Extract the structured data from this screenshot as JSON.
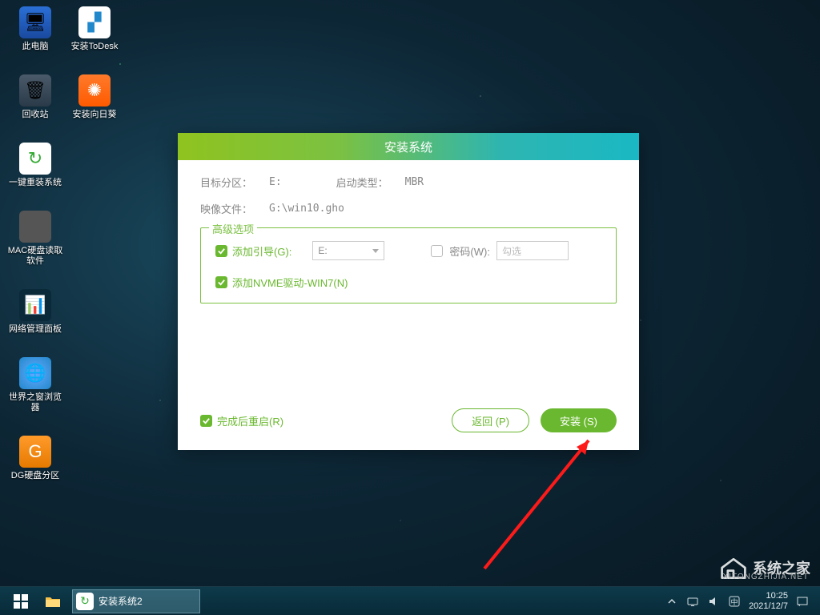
{
  "desktop_icons_col1": [
    {
      "label": "此电脑",
      "cls": "pc-icon",
      "glyph": "🖥"
    },
    {
      "label": "回收站",
      "cls": "recycle",
      "glyph": "🗑"
    },
    {
      "label": "一键重装系统",
      "cls": "reinstall",
      "glyph": "↻"
    },
    {
      "label": "MAC硬盘读取软件",
      "cls": "macdisk",
      "glyph": ""
    },
    {
      "label": "网络管理面板",
      "cls": "netpanel",
      "glyph": "📊"
    },
    {
      "label": "世界之窗浏览器",
      "cls": "browser",
      "glyph": "🌐"
    },
    {
      "label": "DG硬盘分区",
      "cls": "dgdisk",
      "glyph": "G"
    }
  ],
  "desktop_icons_col2": [
    {
      "label": "安装ToDesk",
      "cls": "todesk",
      "glyph": "▞"
    },
    {
      "label": "安装向日葵",
      "cls": "sunflower",
      "glyph": "✺"
    }
  ],
  "dialog": {
    "title": "安装系统",
    "target_label": "目标分区：",
    "target_value": "E:",
    "boottype_label": "启动类型：",
    "boottype_value": "MBR",
    "image_label": "映像文件：",
    "image_value": "G:\\win10.gho",
    "advanced_legend": "高级选项",
    "add_boot_label": "添加引导(G):",
    "add_boot_value": "E:",
    "password_label": "密码(W):",
    "password_placeholder": "勾选",
    "add_nvme_label": "添加NVME驱动-WIN7(N)",
    "restart_label": "完成后重启(R)",
    "btn_back": "返回 (P)",
    "btn_install": "安装 (S)"
  },
  "taskbar": {
    "task_label": "安装系统2",
    "time": "10:25",
    "date": "2021/12/7"
  },
  "watermark": {
    "text": "系统之家",
    "sub": "XITONGZHIJIA.NET"
  }
}
